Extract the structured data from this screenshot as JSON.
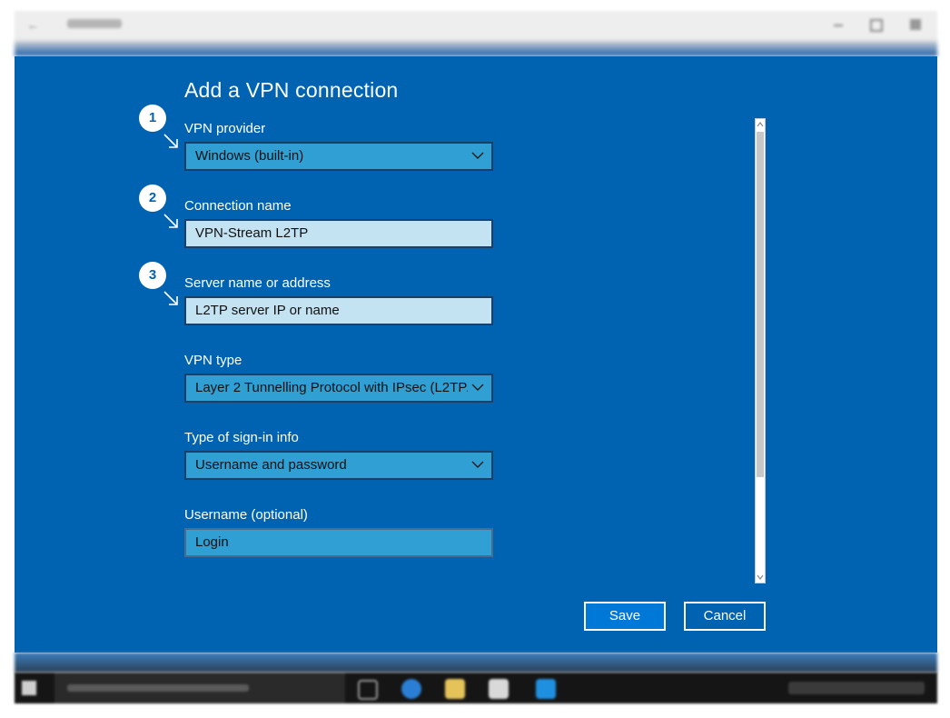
{
  "dialog": {
    "title": "Add a VPN connection",
    "steps": [
      "1",
      "2",
      "3"
    ],
    "fields": {
      "provider": {
        "label": "VPN provider",
        "value": "Windows (built-in)"
      },
      "connection_name": {
        "label": "Connection name",
        "value": "VPN-Stream L2TP"
      },
      "server": {
        "label": "Server name or address",
        "value": "L2TP server IP or name"
      },
      "vpn_type": {
        "label": "VPN type",
        "value": "Layer 2 Tunnelling Protocol with IPsec (L2TP/"
      },
      "signin_type": {
        "label": "Type of sign-in info",
        "value": "Username and password"
      },
      "username": {
        "label": "Username (optional)",
        "value": "Login"
      }
    },
    "buttons": {
      "save": "Save",
      "cancel": "Cancel"
    }
  },
  "colors": {
    "accent": "#0063b1",
    "field_bg": "#c4e3f2",
    "select_bg": "#2f9fd4",
    "button_primary": "#0078d7"
  },
  "icons": [
    "chevron-down-icon",
    "arrow-down-right-icon",
    "scroll-up-icon",
    "scroll-down-icon"
  ]
}
